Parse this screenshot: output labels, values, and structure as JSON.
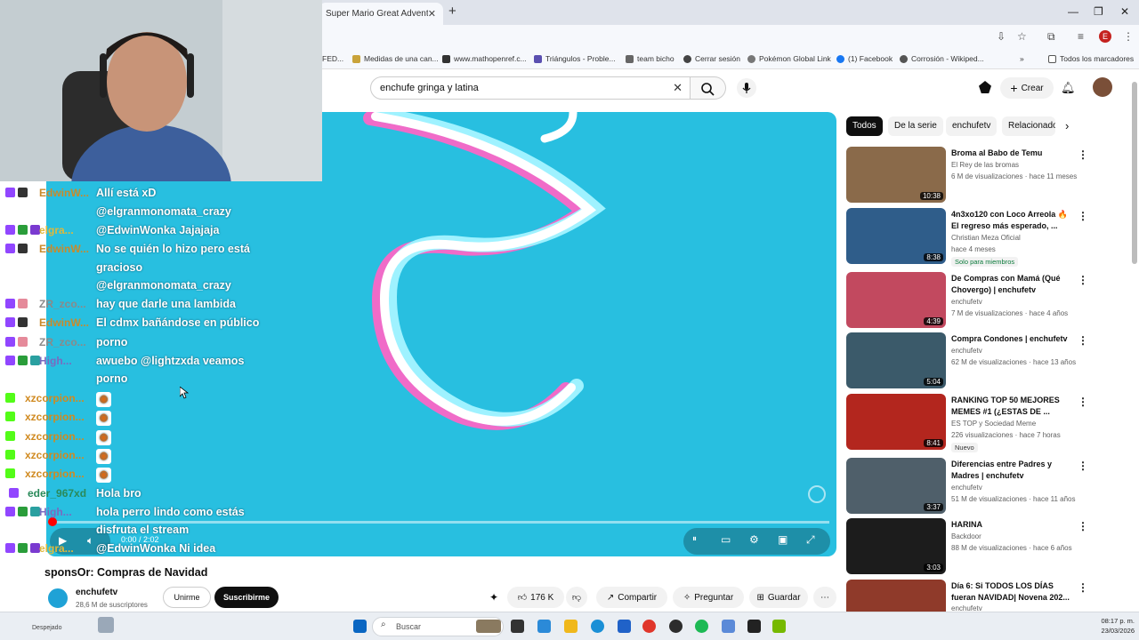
{
  "browser": {
    "tab_title": "Super Mario Great Adventure",
    "tab_close": "✕",
    "new_tab": "+",
    "bookmarks": [
      "FED...",
      "Medidas de una can...",
      "www.mathopenref.c...",
      "Triángulos - Proble...",
      "team bicho",
      "Cerrar sesión",
      "Pokémon Global Link",
      "(1) Facebook",
      "Corrosión - Wikiped..."
    ],
    "bookmarks_more": "»",
    "all_bookmarks": "Todos los marcadores",
    "profile_letter": "E"
  },
  "youtube": {
    "search_value": "enchufe gringa y latina",
    "create_label": "Crear"
  },
  "player": {
    "time": "0:00 / 2:02",
    "progress_percent": 0
  },
  "video": {
    "title_overlay": "sponsOr: Compras de Navidad",
    "channel": "enchufetv",
    "subs": "28,6 M de suscriptores",
    "join_label": "Unirme",
    "subscribe_label": "Suscribirme",
    "likes": "176 K",
    "share_label": "Compartir",
    "ask_label": "Preguntar",
    "save_label": "Guardar"
  },
  "chips": [
    "Todos",
    "De la serie",
    "enchufetv",
    "Relacionado"
  ],
  "recommendations": [
    {
      "title": "Broma al Babo de Temu",
      "channel": "El Rey de las bromas",
      "meta": "6 M de visualizaciones · hace 11 meses",
      "duration": "10:38",
      "thumb_color": "#8a6a4a",
      "badge": ""
    },
    {
      "title": "4n3xo120 con Loco Arreola 🔥 El regreso más esperado, ...",
      "channel": "Christian Meza Oficial",
      "meta": "hace 4 meses",
      "duration": "8:38",
      "thumb_color": "#2f5d8a",
      "badge": "Solo para miembros"
    },
    {
      "title": "De Compras con Mamá (Qué Chovergo) | enchufetv",
      "channel": "enchufetv",
      "meta": "7 M de visualizaciones · hace 4 años",
      "duration": "4:39",
      "thumb_color": "#c2495f",
      "badge": ""
    },
    {
      "title": "Compra Condones | enchufetv",
      "channel": "enchufetv",
      "meta": "62 M de visualizaciones · hace 13 años",
      "duration": "5:04",
      "thumb_color": "#3b5a6a",
      "badge": ""
    },
    {
      "title": "RANKING TOP 50 MEJORES MEMES #1 (¿ESTAS DE ...",
      "channel": "ES TOP y Sociedad Meme",
      "meta": "226 visualizaciones · hace 7 horas",
      "duration": "8:41",
      "thumb_color": "#b3261e",
      "badge": "Nuevo"
    },
    {
      "title": "Diferencias entre Padres y Madres | enchufetv",
      "channel": "enchufetv",
      "meta": "51 M de visualizaciones · hace 11 años",
      "duration": "3:37",
      "thumb_color": "#4f5f6a",
      "badge": ""
    },
    {
      "title": "HARINA",
      "channel": "Backdoor",
      "meta": "88 M de visualizaciones · hace 6 años",
      "duration": "3:03",
      "thumb_color": "#1c1c1c",
      "badge": ""
    },
    {
      "title": "Día 6: Si TODOS LOS DÍAS fueran NAVIDAD| Novena 202...",
      "channel": "enchufetv",
      "meta": "",
      "duration": "",
      "thumb_color": "#8f3a2a",
      "badge": ""
    }
  ],
  "chat": [
    {
      "user": "EdwinW...",
      "color": "#c98a2a",
      "text": "Allí está xD"
    },
    {
      "user": "",
      "color": "#c98a2a",
      "text": "@elgranmonomata_crazy"
    },
    {
      "user": "elgra...",
      "color": "#e0b83a",
      "text": "@EdwinWonka Jajajaja"
    },
    {
      "user": "EdwinW...",
      "color": "#c98a2a",
      "text": "No se quién lo hizo pero está"
    },
    {
      "user": "",
      "color": "#c98a2a",
      "text": "gracioso"
    },
    {
      "user": "",
      "color": "#c98a2a",
      "text": "@elgranmonomata_crazy"
    },
    {
      "user": "ZR_zco...",
      "color": "#8a8a8a",
      "text": "hay que darle una lambida"
    },
    {
      "user": "EdwinW...",
      "color": "#c98a2a",
      "text": "El cdmx bañándose en público"
    },
    {
      "user": "ZR_zco...",
      "color": "#8a8a8a",
      "text": "porno"
    },
    {
      "user": "High...",
      "color": "#7a6ac0",
      "text": "awuebo @lightzxda veamos"
    },
    {
      "user": "",
      "color": "#7a6ac0",
      "text": "porno"
    },
    {
      "user": "xzcorpion...",
      "color": "#d08a20",
      "text": ""
    },
    {
      "user": "xzcorpion...",
      "color": "#d08a20",
      "text": ""
    },
    {
      "user": "xzcorpion...",
      "color": "#d08a20",
      "text": ""
    },
    {
      "user": "xzcorpion...",
      "color": "#d08a20",
      "text": ""
    },
    {
      "user": "xzcorpion...",
      "color": "#d08a20",
      "text": ""
    },
    {
      "user": "eder_967xd",
      "color": "#2a8a5a",
      "text": "Hola bro"
    },
    {
      "user": "High...",
      "color": "#7a6ac0",
      "text": "hola perro lindo como estás"
    },
    {
      "user": "",
      "color": "#7a6ac0",
      "text": "disfruta el stream"
    },
    {
      "user": "elgra...",
      "color": "#e0b83a",
      "text": "@EdwinWonka Ni idea"
    }
  ],
  "taskbar": {
    "search_placeholder": "Buscar",
    "weather": "Despejado",
    "time": "08:17 p. m.",
    "date": "23/03/2026"
  }
}
